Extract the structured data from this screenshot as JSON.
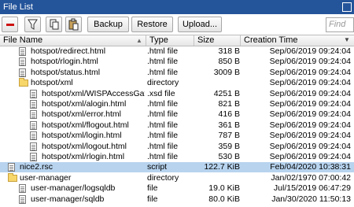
{
  "window": {
    "title": "File List"
  },
  "toolbar": {
    "remove_icon": "minus-icon",
    "filter_icon": "filter-icon",
    "copy_icon": "copy-icon",
    "paste_icon": "paste-icon",
    "backup_label": "Backup",
    "restore_label": "Restore",
    "upload_label": "Upload...",
    "find_placeholder": "Find"
  },
  "columns": {
    "name": "File Name",
    "type": "Type",
    "size": "Size",
    "time": "Creation Time"
  },
  "rows": [
    {
      "kind": "file",
      "indent": 1,
      "name": "hotspot/redirect.html",
      "type": ".html file",
      "size": "318 B",
      "time": "Sep/06/2019 09:24:04"
    },
    {
      "kind": "file",
      "indent": 1,
      "name": "hotspot/rlogin.html",
      "type": ".html file",
      "size": "850 B",
      "time": "Sep/06/2019 09:24:04"
    },
    {
      "kind": "file",
      "indent": 1,
      "name": "hotspot/status.html",
      "type": ".html file",
      "size": "3009 B",
      "time": "Sep/06/2019 09:24:04"
    },
    {
      "kind": "dir",
      "indent": 1,
      "name": "hotspot/xml",
      "type": "directory",
      "size": "",
      "time": "Sep/06/2019 09:24:04"
    },
    {
      "kind": "file",
      "indent": 2,
      "name": "hotspot/xml/WISPAccessGat...",
      "type": ".xsd file",
      "size": "4251 B",
      "time": "Sep/06/2019 09:24:04"
    },
    {
      "kind": "file",
      "indent": 2,
      "name": "hotspot/xml/alogin.html",
      "type": ".html file",
      "size": "821 B",
      "time": "Sep/06/2019 09:24:04"
    },
    {
      "kind": "file",
      "indent": 2,
      "name": "hotspot/xml/error.html",
      "type": ".html file",
      "size": "416 B",
      "time": "Sep/06/2019 09:24:04"
    },
    {
      "kind": "file",
      "indent": 2,
      "name": "hotspot/xml/flogout.html",
      "type": ".html file",
      "size": "361 B",
      "time": "Sep/06/2019 09:24:04"
    },
    {
      "kind": "file",
      "indent": 2,
      "name": "hotspot/xml/login.html",
      "type": ".html file",
      "size": "787 B",
      "time": "Sep/06/2019 09:24:04"
    },
    {
      "kind": "file",
      "indent": 2,
      "name": "hotspot/xml/logout.html",
      "type": ".html file",
      "size": "359 B",
      "time": "Sep/06/2019 09:24:04"
    },
    {
      "kind": "file",
      "indent": 2,
      "name": "hotspot/xml/rlogin.html",
      "type": ".html file",
      "size": "530 B",
      "time": "Sep/06/2019 09:24:04"
    },
    {
      "kind": "file",
      "indent": 0,
      "name": "nice2.rsc",
      "type": "script",
      "size": "122.7 KiB",
      "time": "Feb/04/2020 10:38:31",
      "selected": true
    },
    {
      "kind": "dir",
      "indent": 0,
      "name": "user-manager",
      "type": "directory",
      "size": "",
      "time": "Jan/02/1970 07:00:42"
    },
    {
      "kind": "file",
      "indent": 1,
      "name": "user-manager/logsqldb",
      "type": "file",
      "size": "19.0 KiB",
      "time": "Jul/15/2019 06:47:29"
    },
    {
      "kind": "file",
      "indent": 1,
      "name": "user-manager/sqldb",
      "type": "file",
      "size": "80.0 KiB",
      "time": "Jan/30/2020 11:50:13"
    }
  ],
  "colors": {
    "titlebar": "#24549a",
    "selection": "#b7d3ee",
    "remove": "#cc1111"
  }
}
